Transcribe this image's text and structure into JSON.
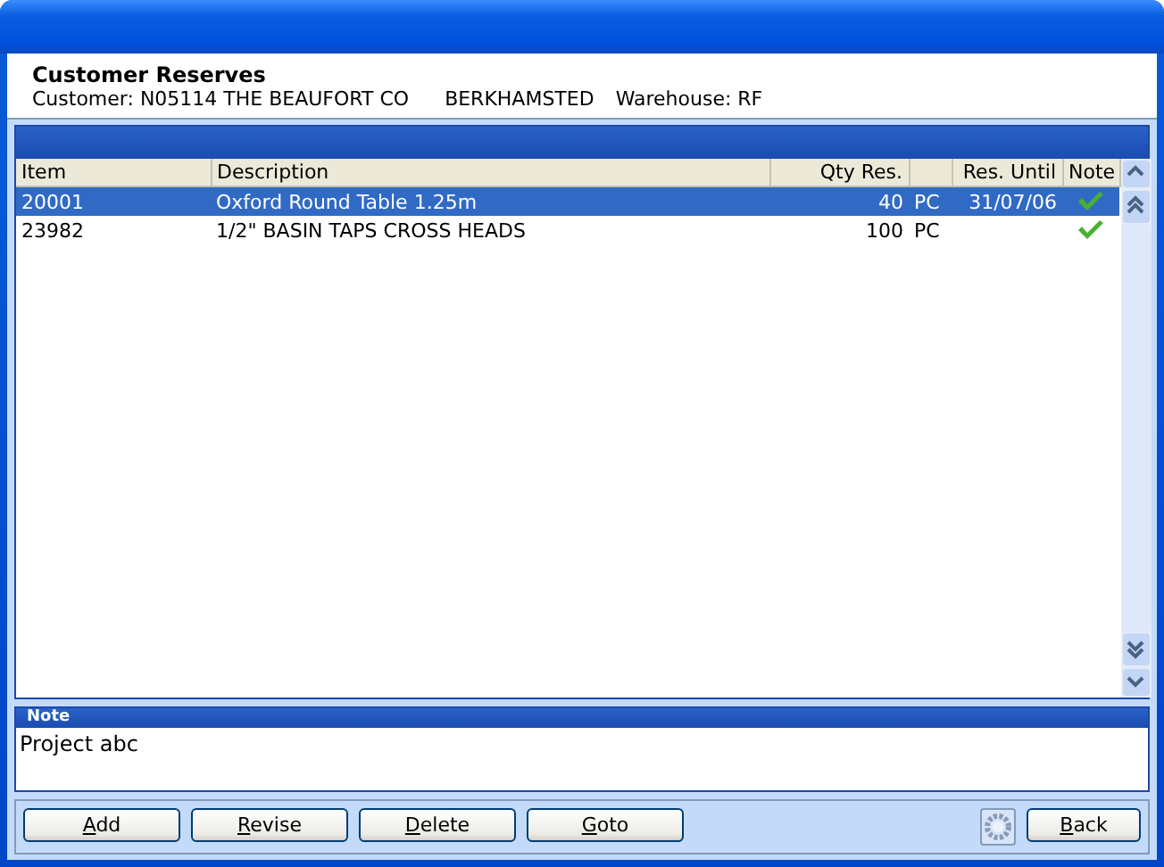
{
  "header": {
    "title": "Customer Reserves",
    "customer": "Customer: N05114 THE BEAUFORT CO",
    "town": "BERKHAMSTED",
    "warehouse": "Warehouse: RF"
  },
  "table": {
    "columns": [
      "Item",
      "Description",
      "Qty Res.",
      "Res. Until",
      "Note"
    ],
    "rows": [
      {
        "item": "20001",
        "description": "Oxford Round Table 1.25m",
        "qty": "40",
        "unit": "PC",
        "until": "31/07/06",
        "note": true,
        "selected": true
      },
      {
        "item": "23982",
        "description": "1/2\" BASIN TAPS CROSS HEADS",
        "qty": "100",
        "unit": "PC",
        "note": true,
        "selected": false
      }
    ]
  },
  "note": {
    "label": "Note",
    "value": "Project abc"
  },
  "buttons_left": [
    "Add",
    "Revise",
    "Delete",
    "Goto"
  ],
  "buttons_right": [
    "Back"
  ]
}
